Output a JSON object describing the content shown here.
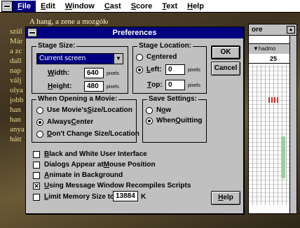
{
  "menubar": {
    "items": [
      {
        "label": "File",
        "ul": "F",
        "rest": "ile"
      },
      {
        "label": "Edit",
        "ul": "E",
        "rest": "dit"
      },
      {
        "label": "Window",
        "ul": "W",
        "rest": "indow"
      },
      {
        "label": "Cast",
        "ul": "C",
        "rest": "ast"
      },
      {
        "label": "Score",
        "ul": "S",
        "rest": "core"
      },
      {
        "label": "Text",
        "ul": "T",
        "rest": "ext"
      },
      {
        "label": "Help",
        "ul": "H",
        "rest": "elp"
      }
    ]
  },
  "background_text": {
    "title": "A hang, a zene a mozgókép",
    "lines": [
      "szül",
      "Már",
      "a zc",
      "dall",
      "nap",
      "válj",
      "olya",
      "jobb",
      "han",
      "han",
      "anya",
      "hátt"
    ]
  },
  "score_window": {
    "title": "ore",
    "label": "▼hadmo",
    "frame": "25"
  },
  "dialog": {
    "title": "Preferences",
    "stage_size": {
      "label": "Stage Size:",
      "select_value": "Current screen",
      "width_label": "Width:",
      "width_ul": "W",
      "width_rest": "idth:",
      "width_value": "640",
      "height_label": "Height:",
      "height_ul": "H",
      "height_rest": "eight:",
      "height_value": "480",
      "unit": "pixels"
    },
    "stage_location": {
      "label": "Stage Location:",
      "centered_ul": "e",
      "centered_pre": "C",
      "centered_post": "ntered",
      "left_ul": "L",
      "left_rest": "eft:",
      "left_value": "0",
      "top_ul": "T",
      "top_rest": "op:",
      "top_value": "0",
      "unit": "pixels"
    },
    "opening_movie": {
      "label": "When Opening a Movie:",
      "opt1_pre": "Use Movie's ",
      "opt1_ul": "S",
      "opt1_post": "ize/Location",
      "opt2_pre": "Always ",
      "opt2_ul": "C",
      "opt2_post": "enter",
      "opt3_ul": "D",
      "opt3_post": "on't Change Size/Location"
    },
    "save_settings": {
      "label": "Save Settings:",
      "opt1_pre": "N",
      "opt1_ul": "o",
      "opt1_post": "w",
      "opt2_pre": "When ",
      "opt2_ul": "Q",
      "opt2_post": "uitting"
    },
    "checkboxes": {
      "c1_ul": "B",
      "c1_post": "lack and White User Interface",
      "c2_pre": "Dialogs Appear at ",
      "c2_ul": "M",
      "c2_post": "ouse Position",
      "c3_ul": "A",
      "c3_post": "nimate in Background",
      "c4_ul": "U",
      "c4_post": "sing Message Window Recompiles Scripts",
      "c5_ul": "L",
      "c5_post": "imit Memory Size to",
      "memory_value": "13884",
      "memory_unit": "K"
    },
    "buttons": {
      "ok": "OK",
      "cancel": "Cancel",
      "help_ul": "H",
      "help_post": "elp"
    }
  }
}
